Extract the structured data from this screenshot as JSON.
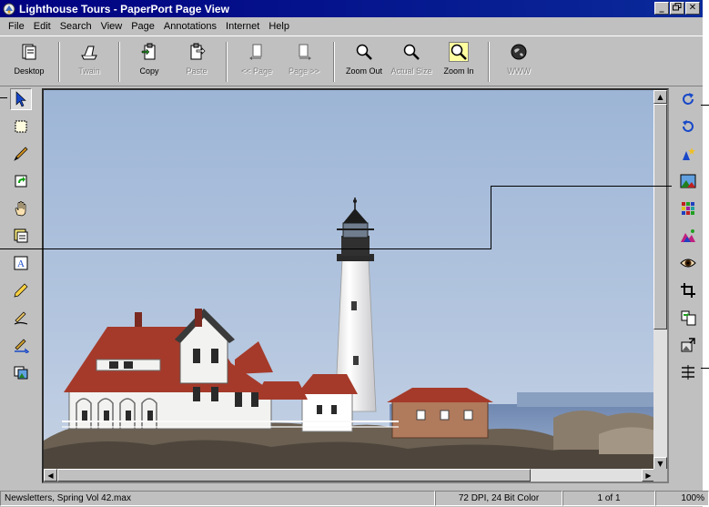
{
  "window": {
    "title": "Lighthouse Tours - PaperPort Page View",
    "controls": [
      "minimize",
      "restore",
      "close"
    ]
  },
  "menu": [
    {
      "label": "File"
    },
    {
      "label": "Edit"
    },
    {
      "label": "Search"
    },
    {
      "label": "View"
    },
    {
      "label": "Page"
    },
    {
      "label": "Annotations"
    },
    {
      "label": "Internet"
    },
    {
      "label": "Help"
    }
  ],
  "toolbar": {
    "desktop": "Desktop",
    "twain": "Twain",
    "copy": "Copy",
    "paste": "Paste",
    "prev_page": "<< Page",
    "next_page": "Page >>",
    "zoom_out": "Zoom Out",
    "actual_size": "Actual Size",
    "zoom_in": "Zoom In",
    "www": "WWW"
  },
  "left_tools": [
    {
      "name": "arrow-pointer-icon",
      "selected": true
    },
    {
      "name": "selection-rectangle-icon"
    },
    {
      "name": "pen-icon"
    },
    {
      "name": "rotate-page-icon"
    },
    {
      "name": "hand-pan-icon"
    },
    {
      "name": "note-icon"
    },
    {
      "name": "text-box-icon"
    },
    {
      "name": "pencil-icon"
    },
    {
      "name": "freehand-pen-icon"
    },
    {
      "name": "highlighter-arrow-icon"
    },
    {
      "name": "picture-stamp-icon"
    }
  ],
  "right_tools": [
    {
      "name": "rotate-right-icon"
    },
    {
      "name": "rotate-left-icon"
    },
    {
      "name": "enhance-wand-icon"
    },
    {
      "name": "color-landscape-icon"
    },
    {
      "name": "color-grid-icon"
    },
    {
      "name": "color-balance-icon"
    },
    {
      "name": "red-eye-icon"
    },
    {
      "name": "crop-icon"
    },
    {
      "name": "copy-to-clipboard-icon"
    },
    {
      "name": "image-export-icon"
    },
    {
      "name": "straighten-icon"
    }
  ],
  "status": {
    "document": "Newsletters, Spring Vol 42.max",
    "resolution": "72 DPI, 24 Bit Color",
    "page": "1 of 1",
    "zoom": "100%"
  },
  "colors": {
    "titlebar": "#000080",
    "chrome": "#c0c0c0",
    "sky": "#aac0dc",
    "roof": "#a53a2a"
  }
}
